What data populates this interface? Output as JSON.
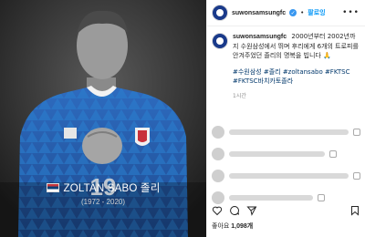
{
  "photo": {
    "jersey_number": "19",
    "caption_name": "ZOLTAN SABO 졸리",
    "caption_dates": "(1972 - 2020)"
  },
  "header": {
    "username": "suwonsamsungfc",
    "separator": "•",
    "follow_label": "팔로잉",
    "more_icon": "more-horizontal-icon"
  },
  "post_caption": {
    "username": "suwonsamsungfc",
    "text": "2000년부터 2002년까지 수원삼성에서 뛰며 후리에게 6개의 트로피를 안겨주었던 졸리의 명복을 빕니다 🙏",
    "tags": "#수원삼성 #졸리 #zoltansabo #FKTSC #FKTSC바치카토졸라",
    "time": "1시간"
  },
  "actions": {
    "like_icon": "heart-icon",
    "comment_icon": "comment-icon",
    "share_icon": "share-icon",
    "save_icon": "bookmark-icon"
  },
  "likes": {
    "prefix": "좋아요",
    "count": "1,098개"
  }
}
